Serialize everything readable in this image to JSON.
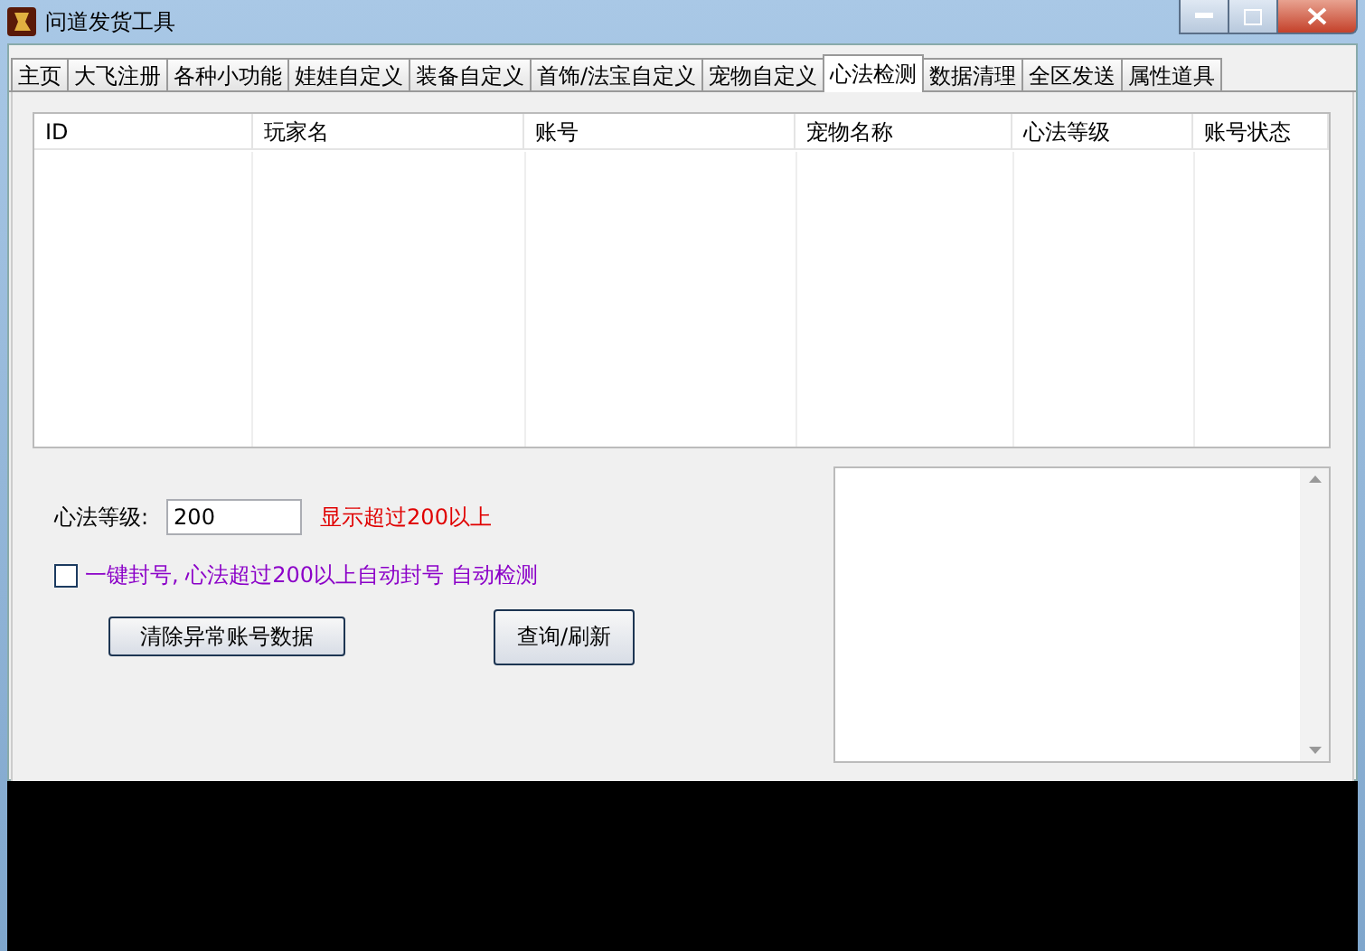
{
  "window": {
    "title": "问道发货工具"
  },
  "tabs": [
    {
      "label": "主页",
      "selected": false
    },
    {
      "label": "大飞注册",
      "selected": false
    },
    {
      "label": "各种小功能",
      "selected": false
    },
    {
      "label": "娃娃自定义",
      "selected": false
    },
    {
      "label": "装备自定义",
      "selected": false
    },
    {
      "label": "首饰/法宝自定义",
      "selected": false
    },
    {
      "label": "宠物自定义",
      "selected": false
    },
    {
      "label": "心法检测",
      "selected": true
    },
    {
      "label": "数据清理",
      "selected": false
    },
    {
      "label": "全区发送",
      "selected": false
    },
    {
      "label": "属性道具",
      "selected": false
    }
  ],
  "table": {
    "columns": [
      "ID",
      "玩家名",
      "账号",
      "宠物名称",
      "心法等级",
      "账号状态"
    ]
  },
  "level_field": {
    "label": "心法等级:",
    "value": "200",
    "hint": "显示超过200以上"
  },
  "auto_ban": {
    "label": "一键封号, 心法超过200以上自动封号 自动检测",
    "checked": false
  },
  "buttons": [
    "清除异常账号数据",
    "查询/刷新"
  ]
}
